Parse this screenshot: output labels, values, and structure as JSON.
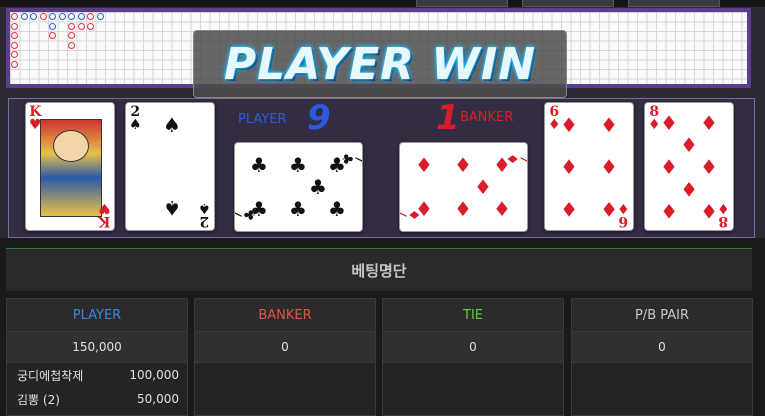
{
  "banner": {
    "text": "PLAYER WIN"
  },
  "player": {
    "label": "PLAYER",
    "score": "9"
  },
  "banker": {
    "label": "BANKER",
    "score": "1"
  },
  "cards": {
    "player_1": {
      "rank": "K",
      "suit": "♥",
      "color": "#d81e2a"
    },
    "player_2": {
      "rank": "2",
      "suit": "♠",
      "color": "#111111"
    },
    "player_3": {
      "rank": "7",
      "suit": "♣",
      "color": "#111111"
    },
    "banker_3": {
      "rank": "7",
      "suit": "♦",
      "color": "#d81e2a"
    },
    "banker_1": {
      "rank": "6",
      "suit": "♦",
      "color": "#d81e2a"
    },
    "banker_2": {
      "rank": "8",
      "suit": "♦",
      "color": "#d81e2a"
    }
  },
  "betting": {
    "title": "베팅명단",
    "columns": [
      {
        "name": "PLAYER",
        "color": "#3a86e0",
        "total": "150,000",
        "bettors": [
          {
            "name": "궁디에첩착제",
            "amount": "100,000"
          },
          {
            "name": "김뽕 (2)",
            "amount": "50,000"
          }
        ]
      },
      {
        "name": "BANKER",
        "color": "#e0544a",
        "total": "0",
        "bettors": []
      },
      {
        "name": "TIE",
        "color": "#5fcf3a",
        "total": "0",
        "bettors": []
      },
      {
        "name": "P/B PAIR",
        "color": "#c8c8c8",
        "total": "0",
        "bettors": []
      }
    ]
  }
}
